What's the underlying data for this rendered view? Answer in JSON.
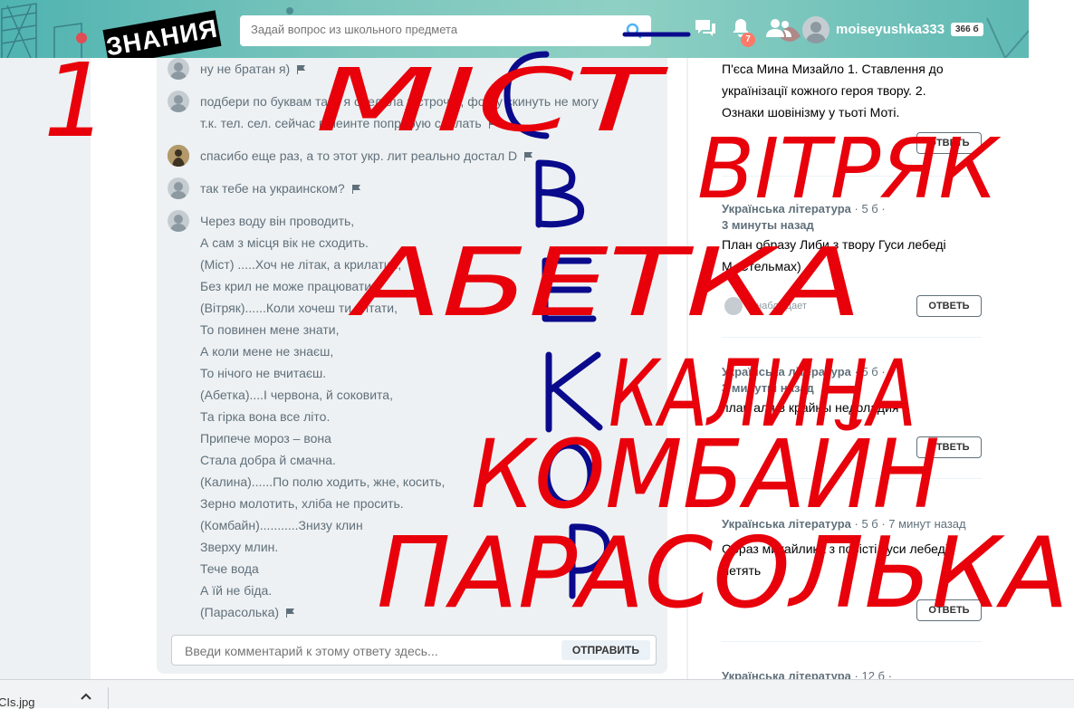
{
  "header": {
    "logo_text": "ЗНАНИЯ",
    "search_placeholder": "Задай вопрос из школьного предмета",
    "notifications_count": "7",
    "username": "moiseyushka333",
    "points": "366 б"
  },
  "comments": [
    {
      "text": "ну не братан я)",
      "avatar": "default"
    },
    {
      "text": "подбери по буквам там, я сделала в строчку, фотку скинуть не могу\nт.к. тел. сел. сейчас в пеинте попробую сделать",
      "avatar": "default"
    },
    {
      "text": "спасибо еще раз, а то этот укр. лит реально достал D",
      "avatar": "custom"
    },
    {
      "text": "так тебе на украинском?",
      "avatar": "default"
    },
    {
      "text": "Через воду він проводить,\nА сам з місця вік не сходить.\n(Міст) .....Хоч не літак, а крилатий,\nБез крил не може працювати.\n(Вітряк)......Коли хочеш ти читати,\nТо повинен мене знати,\nА коли мене не знаєш,\nТо нічого не вчитаєш.\n(Абетка)....І червона, й соковита,\nТа гірка вона все літо.\nПрипече мороз – вона\nСтала добра й смачна.\n(Калина)......По полю ходить, жне, косить,\nЗерно молотить, хліба не просить.\n(Комбайн)...........Знизу клин\nЗверху млин.\nТече вода\nА їй не біда.\n(Парасолька)",
      "avatar": "default"
    }
  ],
  "comment_input": {
    "placeholder": "Введи комментарий к этому ответу здесь...",
    "send_label": "ОТПРАВИТЬ"
  },
  "questions": [
    {
      "meta_subject": "",
      "meta_rest": "",
      "meta_time": "",
      "text": "П'єса Мина Мизайло 1. Ставлення до\nукраїнізації кожного героя твору. 2.\nОзнаки шовінізму у тьоті Моті.",
      "button": "ОТВЕТЬ"
    },
    {
      "meta_subject": "Українська література",
      "meta_rest": " · 5 б ·",
      "meta_time": "3 минуты назад",
      "text": "План образу Либи з твору Гуси лебеді\nМ. Стельмах)",
      "watchers": "1 наблюдает",
      "button": "ОТВЕТЬ"
    },
    {
      "meta_subject": "Українська література",
      "meta_rest": " · 5 б ·",
      "meta_time": "3 минуты назад",
      "text": "план аля в крайны недоладия",
      "button": "ОТВЕТЬ"
    },
    {
      "meta_subject": "Українська література",
      "meta_rest": " · 5 б · 7 минут назад",
      "meta_time": "",
      "text": "Образ михайлика з повісті Гуси лебеді\nлетять",
      "button": "ОТВЕТЬ"
    },
    {
      "meta_subject": "Українська література",
      "meta_rest": " · 12 б ·",
      "meta_time": "",
      "text": "",
      "button": ""
    }
  ],
  "download_bar": {
    "filename": "CIs.jpg"
  },
  "overlay_text": {
    "number": "1",
    "words": [
      "МІСТ",
      "ВІТРЯК",
      "АБЕТКА",
      "КАЛИНА",
      "КОМБАЙН",
      "ПАРАСОЛЬКА"
    ],
    "vertical_letters": [
      "С",
      "В",
      "Е",
      "К",
      "О",
      "Р"
    ],
    "colors": {
      "red": "#e8000b",
      "blue": "#0a0a8c"
    }
  }
}
